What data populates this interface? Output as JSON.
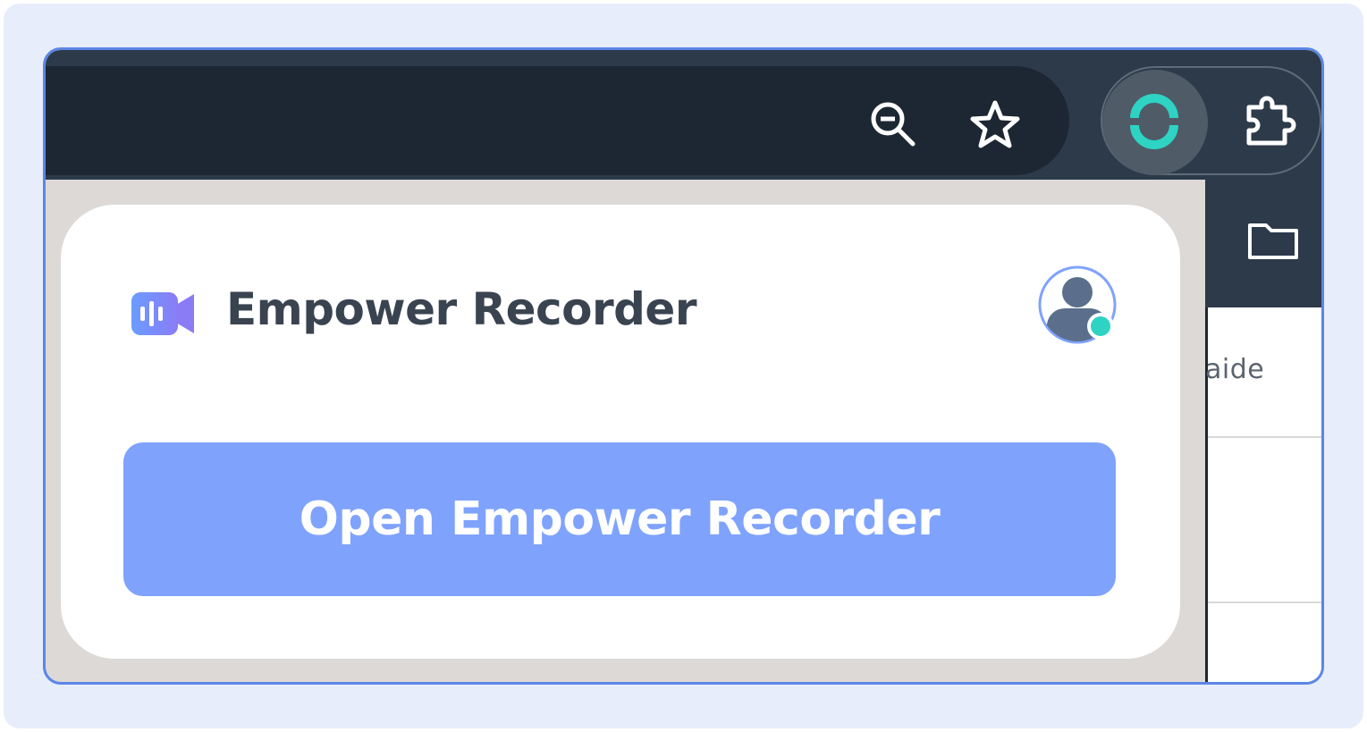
{
  "icons": {
    "zoom": "zoom-out-icon",
    "bookmark": "star-icon",
    "extension_active": "sync-icon",
    "extensions_menu": "puzzle-icon",
    "folder": "folder-icon",
    "app_logo": "recorder-logo-icon",
    "avatar": "user-avatar-icon"
  },
  "page": {
    "partial_text": "aide"
  },
  "popup": {
    "title": "Empower Recorder",
    "button_label": "Open Empower Recorder",
    "status": "online"
  },
  "colors": {
    "accent": "#7fa3fc",
    "brand_teal": "#2ed3c4",
    "frame_border": "#5b86e5",
    "toolbar": "#2c3a4a"
  }
}
